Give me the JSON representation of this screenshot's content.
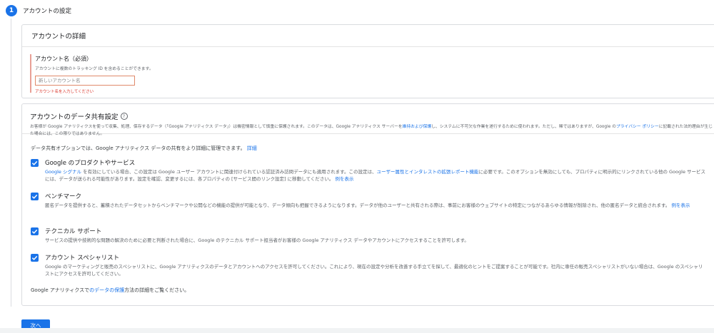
{
  "step": {
    "number": "1",
    "title": "アカウントの設定"
  },
  "account_details": {
    "header": "アカウントの詳細",
    "name_label": "アカウント名（必須）",
    "name_help": "アカウントに複数のトラッキング ID を含めることができます。",
    "name_placeholder": "新しいアカウント名",
    "name_value": "",
    "name_error": "アカウント名を入力してください"
  },
  "data_sharing": {
    "header": "アカウントのデータ共有設定",
    "desc_part1": "お客様が Google アナリティクスを使って収集、処理、保存するデータ（「Google アナリティクス データ」）は機密情報として慎重に保護されます。このデータは、Google アナリティクス サーバーを",
    "desc_link1": "維持および保護",
    "desc_part2": "し、システムに不可欠な作業を遂行するために使われます。ただし、稀ではありますが、Google の",
    "desc_link2": "プライバシー ポリシー",
    "desc_part3": "に記載された法的理由が生じた場合には、この限りではありません。",
    "intro_text": "データ共有オプションでは、Google アナリティクス データの共有をより詳細に管理できます。",
    "intro_link": "詳細",
    "options": [
      {
        "title": "Google のプロダクトやサービス",
        "link_a": "Google シグナル",
        "text_a": " を有効にしている場合、この設定は Google ユーザー アカウントに関連付けられている認証済み訪問データにも適用されます。この設定は、",
        "link_b": "ユーザー属性とインタレストの拡張レポート機能",
        "text_b": "に必要です。このオプションを無効にしても、プロパティに明示的にリンクされている他の Google サービスには、データが送られる可能性があります。設定を確認、変更するには、各プロパティの [サービス間のリンク設定] に移動してください。",
        "link_c": "例を表示",
        "checked": true
      },
      {
        "title": "ベンチマーク",
        "text_a": "匿名データを提供すると、蓄積されたデータセットからベンチマークや公開などの機能の提供が可能となり、データ傾向も把握できるようになります。データが他のユーザーと共有される際は、事前にお客様のウェブサイトの特定につながるあらゆる情報が削除され、他の匿名データと統合されます。",
        "link_c": "例を表示",
        "checked": true
      },
      {
        "title": "テクニカル サポート",
        "text_a": "サービスの提供や技術的な問題の解決のために必要と判断された場合に、Google のテクニカル サポート担当者がお客様の Google アナリティクス データやアカウントにアクセスすることを許可します。",
        "checked": true
      },
      {
        "title": "アカウント スペシャリスト",
        "text_a": "Google のマーケティングと販売のスペシャリストに、Google アナリティクスのデータとアカウントへのアクセスを許可してください。これにより、現在の設定や分析を改善する手立てを探して、最適化のヒントをご提案することが可能です。社内に専任の販売スペシャリストがいない場合は、Google のスペシャリストにアクセスを許可してください。",
        "checked": true
      }
    ],
    "footer_prefix": "Google アナリティクスで",
    "footer_link": "のデータの保護",
    "footer_suffix": "方法の詳細をご覧ください。"
  },
  "next_button": "次へ",
  "colors": {
    "accent": "#1a73e8",
    "error": "#d93025",
    "border": "#dadce0"
  },
  "icons": {
    "checkbox": "check-icon",
    "help": "help-circle-icon"
  }
}
